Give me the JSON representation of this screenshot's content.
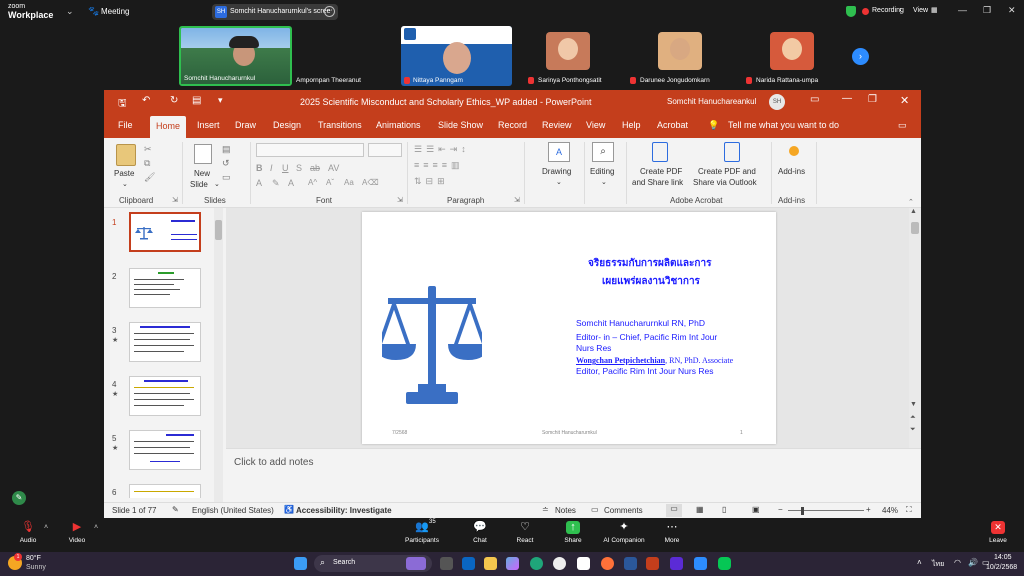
{
  "zoom": {
    "brand_line1": "zoom",
    "brand_line2": "Workplace",
    "meeting_label": "Meeting",
    "share_badge": "SH",
    "share_label": "Somchit Hanucharurnkul's scree",
    "recording_label": "Recording",
    "view_label": "View",
    "participants_tiles": [
      {
        "name": "Somchit Hanucharurnkul",
        "muted": false
      },
      {
        "name": "Ampornpan Theeranut",
        "muted": false
      },
      {
        "name": "Nittaya Panngam",
        "muted": true
      },
      {
        "name": "Sarinya Ponthongsatit",
        "muted": true
      },
      {
        "name": "Darunee Jongudomkarn",
        "muted": true
      },
      {
        "name": "Narida Rattana-umpa",
        "muted": true
      }
    ],
    "bottom_bar": {
      "audio": "Audio",
      "video": "Video",
      "participants": "Participants",
      "participants_count": "35",
      "chat": "Chat",
      "react": "React",
      "share": "Share",
      "ai_companion": "AI Companion",
      "more": "More",
      "leave": "Leave"
    }
  },
  "ppt": {
    "title": "2025 Scientific Misconduct and Scholarly Ethics_WP added  -  PowerPoint",
    "user_name": "Somchit Hanuchareankul",
    "user_initials": "SH",
    "tabs": [
      "File",
      "Home",
      "Insert",
      "Draw",
      "Design",
      "Transitions",
      "Animations",
      "Slide Show",
      "Record",
      "Review",
      "View",
      "Help",
      "Acrobat"
    ],
    "tell_me": "Tell me what you want to do",
    "ribbon": {
      "paste": "Paste",
      "clipboard": "Clipboard",
      "new_slide_1": "New",
      "new_slide_2": "Slide",
      "slides": "Slides",
      "font": "Font",
      "paragraph": "Paragraph",
      "drawing": "Drawing",
      "editing": "Editing",
      "create_pdf_1": "Create PDF",
      "create_pdf_2": "and Share link",
      "create_pdf_outlook_1": "Create PDF and",
      "create_pdf_outlook_2": "Share via Outlook",
      "adobe_acrobat": "Adobe Acrobat",
      "addins_btn": "Add-ins",
      "addins_grp": "Add-ins"
    },
    "thumb_numbers": [
      "1",
      "2",
      "3",
      "4",
      "5",
      "6"
    ],
    "slide": {
      "thai_title_1": "จริยธรรมกับการผลิตและการ",
      "thai_title_2": "เผยแพร่ผลงานวิชาการ",
      "author1": "Somchit Hanucharurnkul RN, PhD",
      "author1_role_1": "Editor- in – Chief, Pacific Rim Int Jour",
      "author1_role_2": "Nurs Res",
      "author2_name": "Wongchan Petpichetchian",
      "author2_rest": ", RN, PhD. Associate",
      "author2_role": "Editor, Pacific Rim Int Jour Nurs Res",
      "footer_left": "7/2568",
      "footer_center": "Somchit Hanucharurnkul",
      "footer_right": "1"
    },
    "notes_placeholder": "Click to add notes",
    "status": {
      "slide_of": "Slide 1 of 77",
      "language": "English (United States)",
      "accessibility": "Accessibility: Investigate",
      "notes": "Notes",
      "comments": "Comments",
      "zoom": "44%"
    }
  },
  "taskbar": {
    "weather_temp": "80°F",
    "weather_desc": "Sunny",
    "search": "Search",
    "lang": "ไทย",
    "time": "14:05",
    "date": "10/2/2568",
    "notif_count": "1"
  },
  "colors": {
    "ppt_accent": "#c43e1c",
    "slide_title_blue": "#1a1aff",
    "scale_blue": "#3a6fc4",
    "zoom_blue": "#2d8cff",
    "record_red": "#e33333"
  }
}
